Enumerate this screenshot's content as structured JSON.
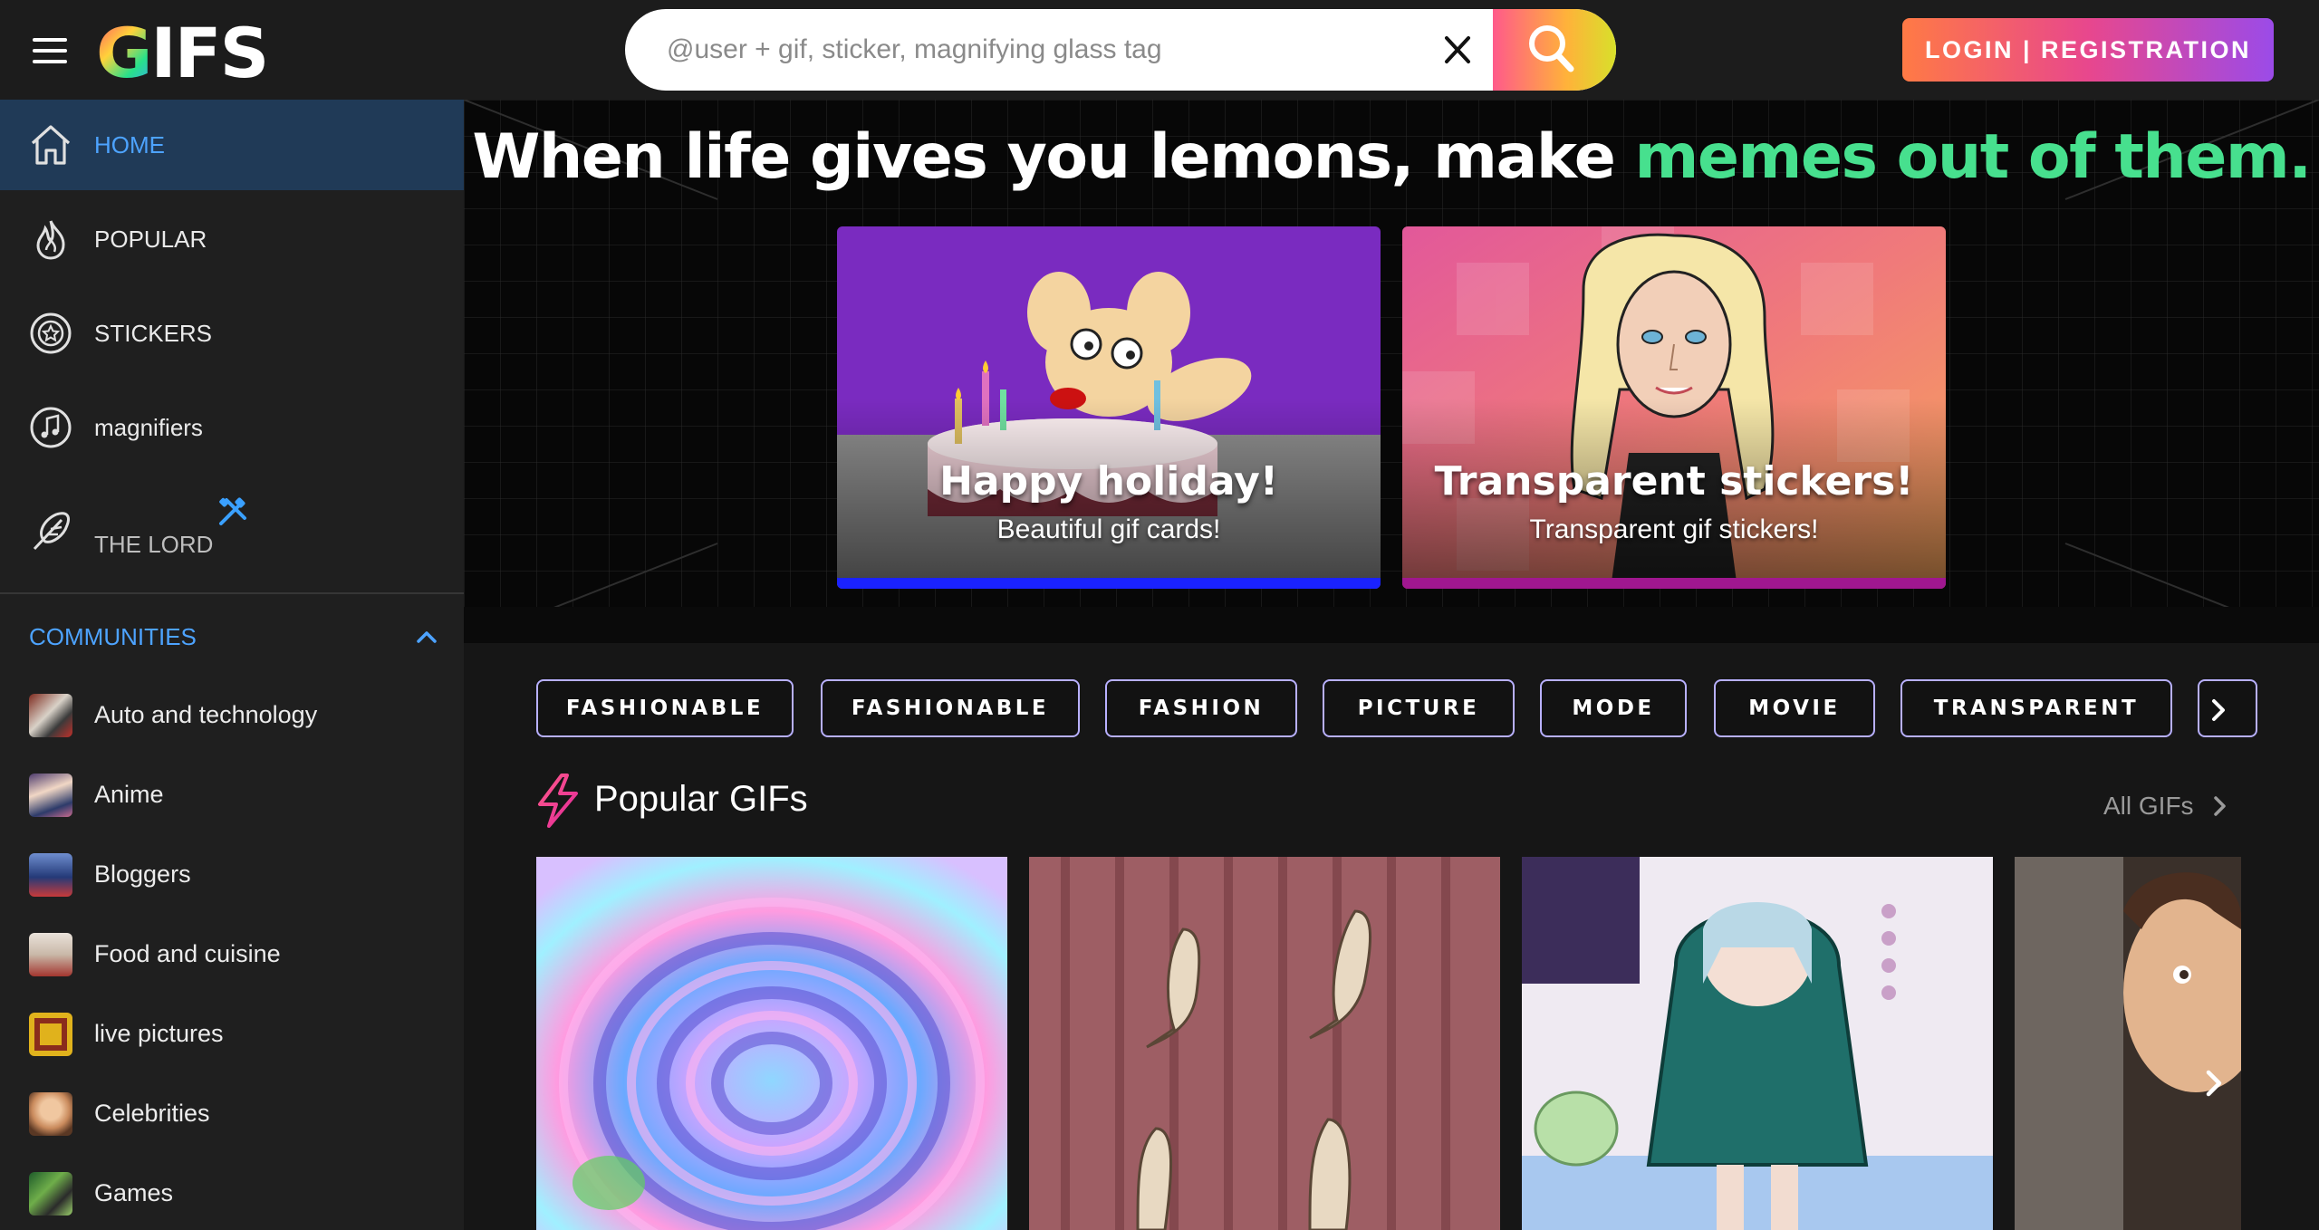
{
  "header": {
    "logo_g": "G",
    "logo_rest": "IFS",
    "search_placeholder": "@user + gif, sticker, magnifying glass tag",
    "login_label": "LOGIN | REGISTRATION"
  },
  "sidebar": {
    "items": [
      {
        "label": "HOME",
        "icon": "home-icon",
        "active": true
      },
      {
        "label": "POPULAR",
        "icon": "flame-icon"
      },
      {
        "label": "STICKERS",
        "icon": "sticker-icon"
      },
      {
        "label": "magnifiers",
        "icon": "music-note-icon"
      },
      {
        "label": "THE LORD",
        "icon": "feather-icon",
        "badge_icon": "tools-icon"
      }
    ],
    "communities_label": "COMMUNITIES",
    "communities": [
      {
        "label": "Auto and technology"
      },
      {
        "label": "Anime"
      },
      {
        "label": "Bloggers"
      },
      {
        "label": "Food and cuisine"
      },
      {
        "label": "live pictures"
      },
      {
        "label": "Celebrities"
      },
      {
        "label": "Games"
      }
    ]
  },
  "hero": {
    "title_part1": "When life gives you lemons, make ",
    "title_part2": "memes out of them.",
    "accent_color": "#47e08e",
    "cards": [
      {
        "title": "Happy holiday!",
        "subtitle": "Beautiful gif cards!",
        "bar_color": "#1a22ff"
      },
      {
        "title": "Transparent stickers!",
        "subtitle": "Transparent gif stickers!",
        "bar_color": "#a0178f"
      }
    ]
  },
  "tags": [
    "FASHIONABLE",
    "FASHIONABLE",
    "FASHION",
    "PICTURE",
    "MODE",
    "MOVIE",
    "TRANSPARENT"
  ],
  "popular": {
    "title": "Popular GIFs",
    "all_link": "All GIFs"
  }
}
